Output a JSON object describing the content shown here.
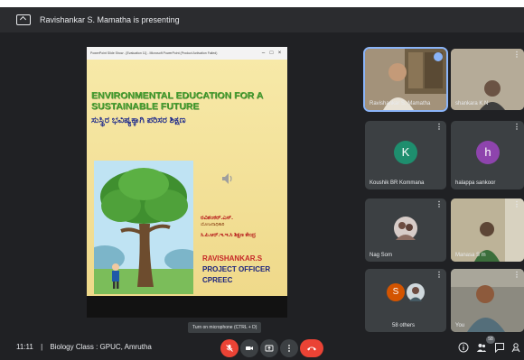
{
  "presenting_bar": {
    "text": "Ravishankar S. Mamatha is presenting",
    "icon": "present-screen-icon"
  },
  "ppt_window": {
    "title": "PowerPoint Slide Show - [Evaluation 11] - Microsoft PowerPoint (Product Activation Failed)",
    "buttons": [
      "–",
      "□",
      "×"
    ]
  },
  "slide": {
    "title": "ENVIRONMENTAL EDUCATION FOR A SUSTAINABLE FUTURE",
    "title_kannada": "ಸುಸ್ಥಿರ ಭವಿಷ್ಯಕ್ಕಾಗಿ ಪರಿಸರ ಶಿಕ್ಷಣ",
    "presenter_kannada": "ರವಿಶಂಕರ್.ಎಸ್.",
    "role_kannada": "ಯೋಜನಾಧಿಕಾರಿ",
    "org_kannada": "ಸಿ.ಪಿ.ಆರ್.ಇ.ಇ.ಸಿ ಶಿಕ್ಷಣ ಕೇಂದ್ರ",
    "presenter": "RAVISHANKAR.S",
    "role": "PROJECT OFFICER",
    "org": "CPREEC",
    "colors": {
      "title": "#4aa032",
      "kannada": "#1e2a8c",
      "name": "#c62828",
      "role": "#1a237e",
      "background": "#f3e39a"
    }
  },
  "participants": [
    {
      "name": "Ravishankar S. Mamatha",
      "type": "video",
      "pinned": true
    },
    {
      "name": "shankara K N",
      "type": "video"
    },
    {
      "name": "Koushik BR Kommana",
      "type": "avatar",
      "initial": "K",
      "color": "#1e8e6e"
    },
    {
      "name": "halappa sankoor",
      "type": "avatar",
      "initial": "h",
      "color": "#8e44ad"
    },
    {
      "name": "Nag Som",
      "type": "photo"
    },
    {
      "name": "Manasa S m",
      "type": "video"
    },
    {
      "name": "58 others",
      "type": "group",
      "initial": "S",
      "color": "#d35400"
    },
    {
      "name": "You",
      "type": "video"
    }
  ],
  "tile_more_icon": "⋮",
  "bottom_bar": {
    "time": "11:11",
    "meeting_name": "Biology Class : GPUC, Amrutha",
    "tooltip": "Turn on microphone (CTRL + D)",
    "participant_count": "58"
  },
  "controls": {
    "mic": "mic-off-icon",
    "camera": "camera-icon",
    "present": "present-icon",
    "more": "more-options-icon",
    "leave": "hang-up-icon",
    "info": "info-icon",
    "people": "people-icon",
    "chat": "chat-icon",
    "activities": "activities-icon"
  }
}
